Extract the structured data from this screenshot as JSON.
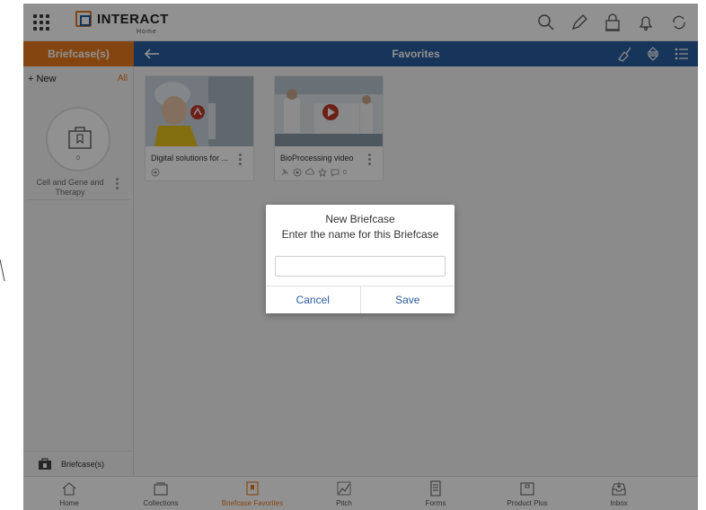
{
  "topbar": {
    "logo_text": "INTERACT",
    "logo_sub": "Home",
    "icons": [
      "search-icon",
      "edit-icon",
      "lock-icon",
      "bell-icon",
      "sync-icon"
    ]
  },
  "sidebar": {
    "header": "Briefcase(s)",
    "new_label": "+ New",
    "all_label": "All",
    "briefcase": {
      "name": "Cell and Gene and Therapy",
      "count": "0"
    },
    "footer_label": "Briefcase(s)"
  },
  "main": {
    "title": "Favorites",
    "cards": [
      {
        "title": "Digital solutions for ...",
        "type": "pdf"
      },
      {
        "title": "BioProcessing video",
        "type": "video",
        "comment_count": "0"
      }
    ]
  },
  "dialog": {
    "title": "New Briefcase",
    "message": "Enter the name for this Briefcase",
    "input_value": "",
    "cancel_label": "Cancel",
    "save_label": "Save"
  },
  "bottomnav": {
    "items": [
      {
        "label": "Home",
        "icon": "home-icon"
      },
      {
        "label": "Collections",
        "icon": "collections-icon"
      },
      {
        "label": "Briefcase Favorites",
        "icon": "bookmark-icon",
        "active": true
      },
      {
        "label": "Pitch",
        "icon": "pitch-icon"
      },
      {
        "label": "Forms",
        "icon": "forms-icon"
      },
      {
        "label": "Product Plus",
        "icon": "product-plus-icon"
      },
      {
        "label": "Inbox",
        "icon": "inbox-icon"
      }
    ]
  },
  "colors": {
    "accent": "#e8791f",
    "primary": "#2a5d9f"
  }
}
